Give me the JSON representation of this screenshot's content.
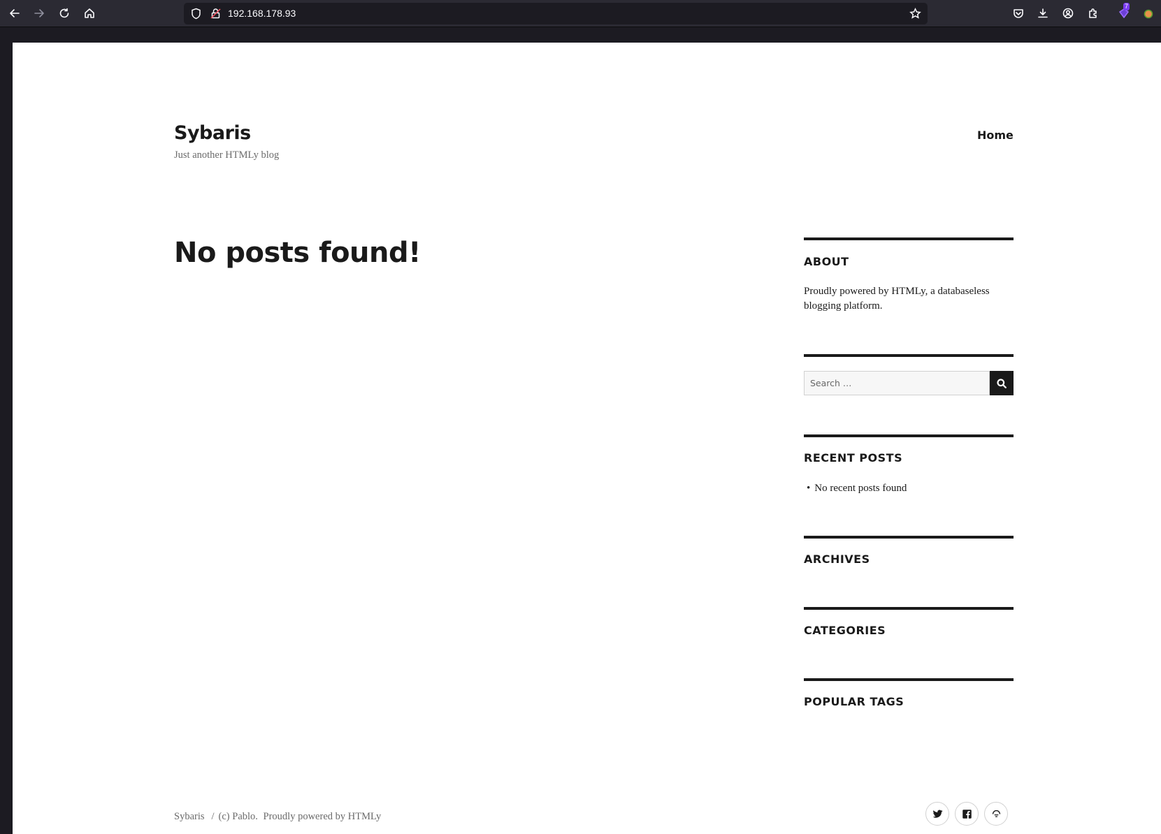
{
  "browser": {
    "url": "192.168.178.93",
    "extension_badge_count": "7"
  },
  "site": {
    "title": "Sybaris",
    "description": "Just another HTMLy blog",
    "nav": {
      "home": "Home"
    }
  },
  "main": {
    "heading": "No posts found!"
  },
  "sidebar": {
    "about": {
      "title": "ABOUT",
      "text": "Proudly powered by HTMLy, a databaseless blogging platform."
    },
    "search": {
      "placeholder": "Search …"
    },
    "recent_posts": {
      "title": "RECENT POSTS",
      "items": [
        "No recent posts found"
      ]
    },
    "archives": {
      "title": "ARCHIVES"
    },
    "categories": {
      "title": "CATEGORIES"
    },
    "popular_tags": {
      "title": "POPULAR TAGS"
    }
  },
  "footer": {
    "site_name": "Sybaris",
    "separator": "/",
    "copyright": "(c) Pablo.",
    "powered": "Proudly powered by HTMLy",
    "social": [
      "twitter-icon",
      "facebook-icon",
      "feed-icon"
    ]
  },
  "colors": {
    "toolbar_bg": "#2b2a33",
    "frame_bg": "#1c1b22",
    "page_bg": "#ffffff",
    "text_primary": "#1a1a1a",
    "text_secondary": "#6b6b6b"
  }
}
